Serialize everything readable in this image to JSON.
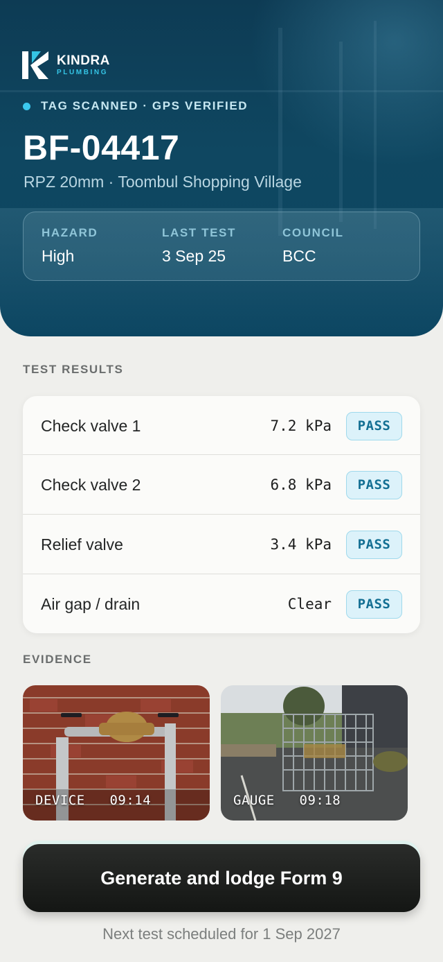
{
  "brand": {
    "name": "KINDRA",
    "sub": "PLUMBING"
  },
  "status": {
    "text": "TAG SCANNED · GPS VERIFIED",
    "dot_color": "#3bc8ee"
  },
  "device": {
    "id": "BF-04417",
    "subtitle": "RPZ 20mm · Toombul Shopping Village"
  },
  "meta": [
    {
      "label": "HAZARD",
      "value": "High"
    },
    {
      "label": "LAST TEST",
      "value": "3 Sep 25"
    },
    {
      "label": "COUNCIL",
      "value": "BCC"
    }
  ],
  "results": {
    "heading": "TEST RESULTS",
    "rows": [
      {
        "name": "Check valve 1",
        "value": "7.2 kPa",
        "status": "PASS"
      },
      {
        "name": "Check valve 2",
        "value": "6.8 kPa",
        "status": "PASS"
      },
      {
        "name": "Relief valve",
        "value": "3.4 kPa",
        "status": "PASS"
      },
      {
        "name": "Air gap / drain",
        "value": "Clear",
        "status": "PASS"
      }
    ]
  },
  "evidence": {
    "heading": "EVIDENCE",
    "photos": [
      {
        "label": "DEVICE",
        "time": "09:14"
      },
      {
        "label": "GAUGE",
        "time": "09:18"
      }
    ]
  },
  "cta": {
    "label": "Generate and lodge Form 9"
  },
  "footer": {
    "text": "Next test scheduled for 1 Sep 2027"
  },
  "colors": {
    "accent": "#35c5e6",
    "pass": "#136f93",
    "hero": "#0f4761"
  }
}
